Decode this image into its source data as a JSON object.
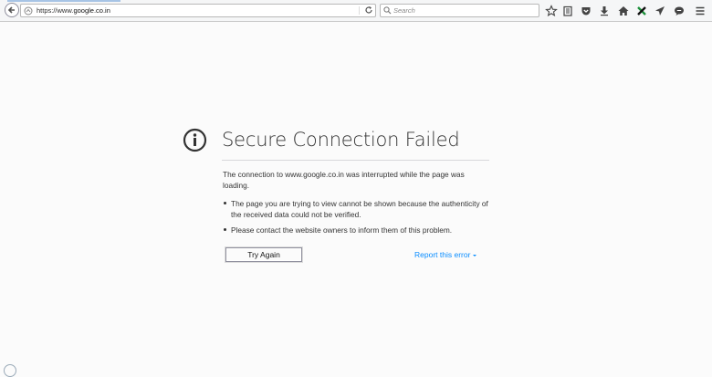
{
  "browser": {
    "url": "https://www.google.co.in",
    "url_prefix": "https://www.",
    "url_domain": "google.co.in",
    "search_placeholder": "Search",
    "toolbar_icons": [
      "star-icon",
      "reading-list-icon",
      "pocket-icon",
      "download-icon",
      "home-icon",
      "extension-x-icon",
      "send-icon",
      "chat-icon",
      "menu-icon"
    ]
  },
  "error_page": {
    "title": "Secure Connection Failed",
    "description": "The connection to www.google.co.in was interrupted while the page was loading.",
    "bullets": [
      "The page you are trying to view cannot be shown because the authenticity of the received data could not be verified.",
      "Please contact the website owners to inform them of this problem."
    ],
    "try_again_label": "Try Again",
    "report_label": "Report this error"
  },
  "colors": {
    "link": "#0a8dff",
    "text": "#333333",
    "background": "#fbfbfb"
  }
}
